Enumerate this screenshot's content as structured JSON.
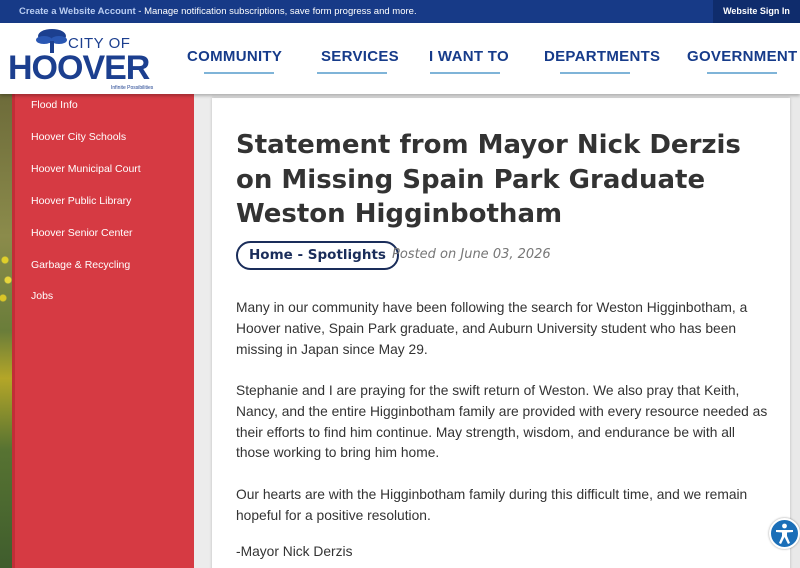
{
  "topbar": {
    "create_account": "Create a Website Account",
    "message": " - Manage notification subscriptions, save form progress and more.",
    "signin": "Website Sign In"
  },
  "logo": {
    "city_of": "CITY OF",
    "hoover": "HOOVER",
    "tagline": "Infinite Possibilities"
  },
  "nav": [
    "COMMUNITY",
    "SERVICES",
    "I WANT TO",
    "DEPARTMENTS",
    "GOVERNMENT"
  ],
  "sidebar": {
    "items": [
      "Flood Info",
      "Hoover City Schools",
      "Hoover Municipal Court",
      "Hoover Public Library",
      "Hoover Senior Center",
      "Garbage & Recycling",
      "Jobs"
    ]
  },
  "article": {
    "title": "Statement from Mayor Nick Derzis on Missing Spain Park Graduate Weston Higginbotham",
    "category": "Home - Spotlights",
    "posted": "Posted on June 03, 2026",
    "paragraphs": [
      "Many in our community have been following the search for Weston Higginbotham, a Hoover native, Spain Park graduate, and Auburn University student who has been missing in Japan since May 29.",
      "Stephanie and I are praying for the swift return of Weston. We also pray that Keith, Nancy, and the entire Higginbotham family are provided with every resource needed as their efforts to find him continue. May strength, wisdom, and endurance be with all those working to bring him home.",
      "Our hearts are with the Higginbotham family during this difficult time, and we remain hopeful for a positive resolution."
    ],
    "signature": "-Mayor Nick Derzis"
  },
  "icons": {
    "accessibility": "accessibility-icon",
    "logo_tree": "tree-icon"
  },
  "colors": {
    "brand_blue": "#173a87",
    "sidebar_red": "#d63a43",
    "accent_light_blue": "#7fb4d8"
  }
}
